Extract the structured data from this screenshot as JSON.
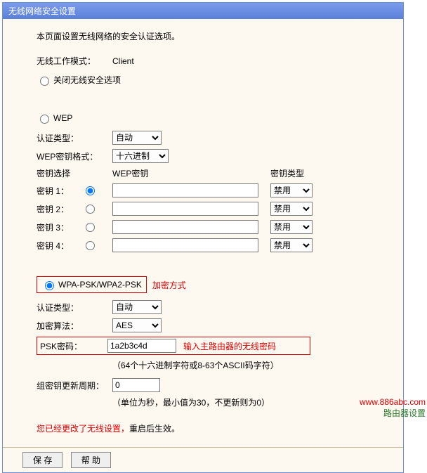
{
  "titlebar": "无线网络安全设置",
  "intro": "本页面设置无线网络的安全认证选项。",
  "mode_label": "无线工作模式：",
  "mode_value": "Client",
  "opt_off": "关闭无线安全选项",
  "opt_wep": "WEP",
  "wep": {
    "auth_label": "认证类型：",
    "auth_value": "自动",
    "keyfmt_label": "WEP密钥格式：",
    "keyfmt_value": "十六进制",
    "select_label": "密钥选择",
    "key_header": "WEP密钥",
    "type_header": "密钥类型",
    "rows": [
      {
        "label": "密钥 1：",
        "val": "",
        "type": "禁用",
        "checked": true
      },
      {
        "label": "密钥 2：",
        "val": "",
        "type": "禁用",
        "checked": false
      },
      {
        "label": "密钥 3：",
        "val": "",
        "type": "禁用",
        "checked": false
      },
      {
        "label": "密钥 4：",
        "val": "",
        "type": "禁用",
        "checked": false
      }
    ]
  },
  "wpa": {
    "radio": "WPA-PSK/WPA2-PSK",
    "annot": "加密方式",
    "auth_label": "认证类型：",
    "auth_value": "自动",
    "algo_label": "加密算法：",
    "algo_value": "AES",
    "psk_label": "PSK密码：",
    "psk_value": "1a2b3c4d",
    "psk_annot": "输入主路由器的无线密码",
    "psk_hint": "（64个十六进制字符或8-63个ASCII码字符）",
    "gk_label": "组密钥更新周期：",
    "gk_value": "0",
    "gk_hint": "（单位为秒，最小值为30，不更新则为0）"
  },
  "footer": {
    "p1": "您已经更改了无线设置，",
    "p2": "重启后生效。"
  },
  "buttons": {
    "save": "保 存",
    "help": "帮 助"
  },
  "watermark": {
    "l1": "www.886abc.com",
    "l2": "路由器设置"
  }
}
